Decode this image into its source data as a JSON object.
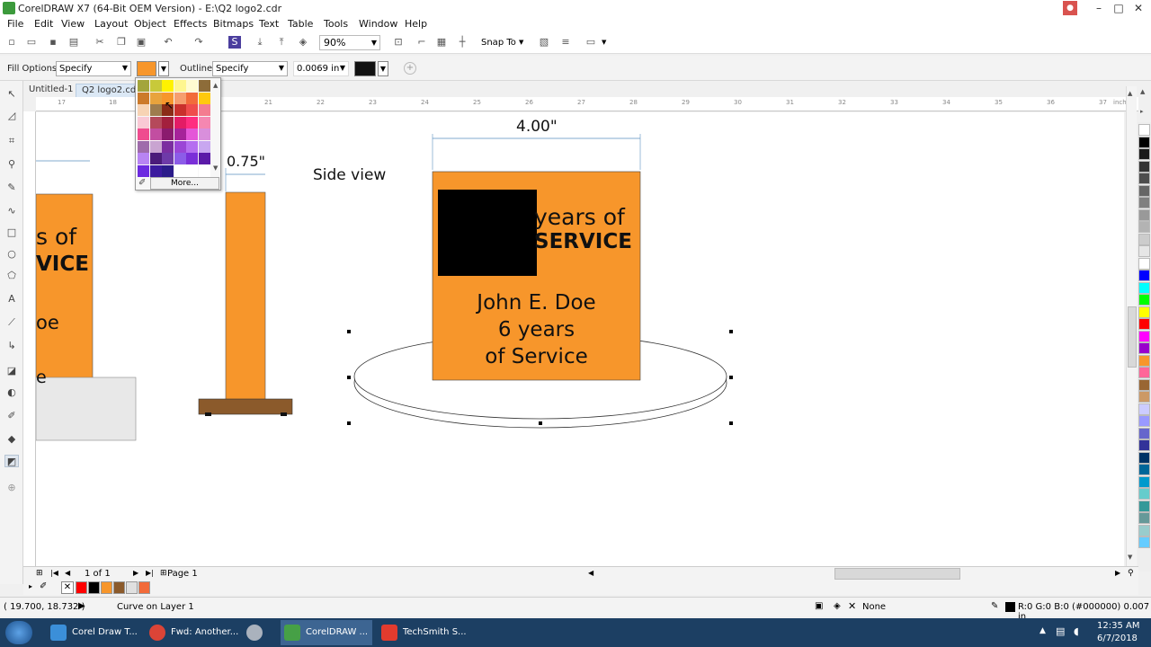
{
  "window": {
    "title": "CorelDRAW X7 (64-Bit OEM Version) - E:\\Q2 logo2.cdr",
    "controls": [
      "–",
      "□",
      "✕"
    ]
  },
  "menu": [
    "File",
    "Edit",
    "View",
    "Layout",
    "Object",
    "Effects",
    "Bitmaps",
    "Text",
    "Table",
    "Tools",
    "Window",
    "Help"
  ],
  "toolbar": {
    "zoom": "90%",
    "snap_to": "Snap To"
  },
  "property_bar": {
    "fill_options_label": "Fill Options:",
    "fill_options_value": "Specify",
    "fill_color": "#f7962b",
    "outline_label": "Outline:",
    "outline_value": "Specify",
    "outline_width": "0.0069 in",
    "outline_color": "#111111"
  },
  "doc_tabs": [
    "Untitled-1",
    "Q2 logo2.cdr"
  ],
  "ruler": {
    "units": "inches",
    "h_ticks": [
      "17",
      "18",
      "21",
      "22",
      "23",
      "24",
      "25",
      "26",
      "27",
      "28",
      "29",
      "30",
      "31",
      "32",
      "33",
      "34",
      "35",
      "36",
      "37"
    ]
  },
  "color_popup": {
    "more_label": "More...",
    "colors": [
      [
        "#a3a53b",
        "#c8c93a",
        "#fff200",
        "#fef68f",
        "#fffbd2",
        "#8d6c39"
      ],
      [
        "#cc7a2a",
        "#e8a33d",
        "#f7962b",
        "#f69e6f",
        "#f26b3a",
        "#ffc90e"
      ],
      [
        "#f7d3b4",
        "#9e7c4e",
        "#8b2c17",
        "#c9302c",
        "#ef4c4c",
        "#f47c90"
      ],
      [
        "#f9c9d5",
        "#b5495b",
        "#a3203d",
        "#e31c65",
        "#ff2d80",
        "#f587b1"
      ],
      [
        "#ef4c8f",
        "#c24ea1",
        "#8b1b6e",
        "#a6239a",
        "#e456d8",
        "#d98fdc"
      ],
      [
        "#9f6bab",
        "#c9a4d1",
        "#7b2ea0",
        "#9b45d6",
        "#b56ef0",
        "#c8a7f0"
      ],
      [
        "#b884f3",
        "#4b1b7a",
        "#6e3aa8",
        "#8c5ce8",
        "#7a2fd8",
        "#5b1aa8"
      ],
      [
        "#6c2ae0",
        "#3b1a9e",
        "#2b1b8a",
        "#ffffff",
        "#ffffff",
        "#ffffff"
      ]
    ]
  },
  "drawing": {
    "dim_top": "4.00\"",
    "dim_side": "0.75\"",
    "side_view_label": "Side view",
    "plaque_line1": "years of",
    "plaque_line2": "SERVICE",
    "name_line1": "John E. Doe",
    "name_line2": "6 years",
    "name_line3": "of Service",
    "left_partial1": "s of",
    "left_partial2": "VICE",
    "left_partial3": "oe",
    "left_partial4": "e",
    "orange": "#f7962b",
    "brown": "#8b5a2b"
  },
  "page_nav": {
    "page_count": "1 of 1",
    "page_tab": "Page 1"
  },
  "status": {
    "coords": "( 19.700, 18.732 )",
    "object": "Curve on Layer 1",
    "fill": "None",
    "outline": "R:0 G:0 B:0 (#000000)  0.007 in"
  },
  "palette": [
    "#ffffff",
    "#000000",
    "#1a1a1a",
    "#333333",
    "#4d4d4d",
    "#666666",
    "#808080",
    "#999999",
    "#b3b3b3",
    "#cccccc",
    "#e6e6e6",
    "#ffffff",
    "#0000ff",
    "#00ffff",
    "#00ff00",
    "#ffff00",
    "#ff0000",
    "#ff00ff",
    "#9900cc",
    "#f7962b",
    "#ff6699",
    "#996633",
    "#cc9966",
    "#ccccff",
    "#9999ff",
    "#6666cc",
    "#333399",
    "#003366",
    "#006699",
    "#0099cc",
    "#66cccc",
    "#339999",
    "#669999",
    "#99cccc",
    "#66ccff"
  ],
  "doc_palette": [
    "#ff0000",
    "#000000",
    "#f7962b",
    "#8b5a2b",
    "#e0e0e0",
    "#f26b3a"
  ],
  "taskbar": {
    "items": [
      "Corel Draw T...",
      "Fwd: Another...",
      "",
      "CorelDRAW ...",
      "TechSmith S..."
    ],
    "time": "12:35 AM",
    "date": "6/7/2018"
  }
}
